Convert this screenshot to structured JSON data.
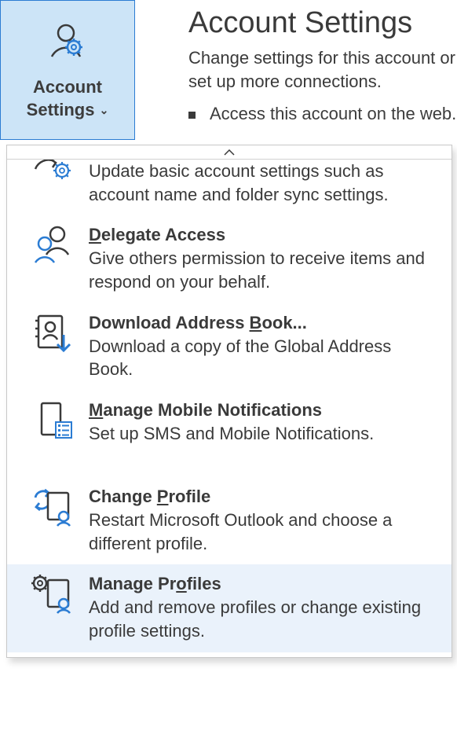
{
  "ribbon": {
    "line1": "Account",
    "line2": "Settings"
  },
  "header": {
    "title": "Account Settings",
    "subtitle": "Change settings for this account or set up more connections.",
    "bullet1": "Access this account on the web."
  },
  "menu": {
    "partial_desc": "Update basic account settings such as account name and folder sync settings.",
    "items": [
      {
        "title_pre": "",
        "title_u": "D",
        "title_post": "elegate Access",
        "desc": "Give others permission to receive items and respond on your behalf."
      },
      {
        "title_pre": "Download Address ",
        "title_u": "B",
        "title_post": "ook...",
        "desc": "Download a copy of the Global Address Book."
      },
      {
        "title_pre": "",
        "title_u": "M",
        "title_post": "anage Mobile Notifications",
        "desc": "Set up SMS and Mobile Notifications."
      },
      {
        "title_pre": "Change ",
        "title_u": "P",
        "title_post": "rofile",
        "desc": "Restart Microsoft Outlook and choose a different profile."
      },
      {
        "title_pre": "Manage Pr",
        "title_u": "o",
        "title_post": "files",
        "desc": "Add and remove profiles or change existing profile settings."
      }
    ]
  }
}
